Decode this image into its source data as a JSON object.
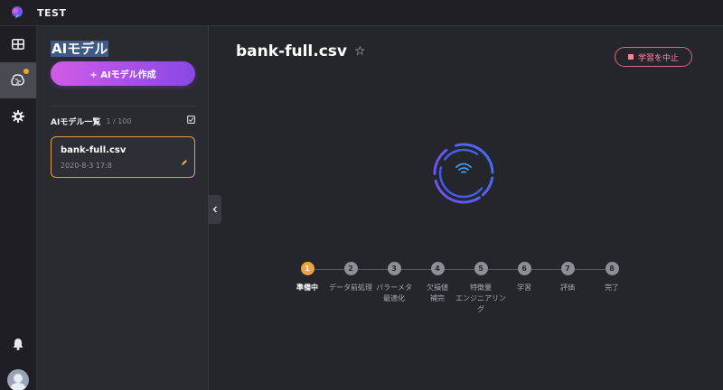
{
  "app": {
    "title": "TEST"
  },
  "colors": {
    "accent_gradient_start": "#d15ce6",
    "accent_gradient_end": "#8a48e6",
    "current_step": "#f1a23a",
    "stop_button": "#ff8aa0",
    "notification_dot": "#f5a623"
  },
  "rail": {
    "items": [
      {
        "icon": "dashboard-icon"
      },
      {
        "icon": "ai-model-icon",
        "active": true,
        "badge": true
      },
      {
        "icon": "gear-icon"
      }
    ],
    "bottom": [
      {
        "icon": "bell-icon"
      },
      {
        "icon": "avatar"
      }
    ]
  },
  "panel": {
    "title": "AIモデル",
    "create_button": "+ AIモデル作成",
    "list_title": "AIモデル一覧",
    "list_count": "1 / 100",
    "models": [
      {
        "name": "bank-full.csv",
        "date": "2020-8-3 17:8"
      }
    ]
  },
  "main": {
    "title": "bank-full.csv",
    "star": "☆",
    "stop_button": "学習を中止",
    "steps": [
      {
        "num": "1",
        "label": "準備中",
        "current": true
      },
      {
        "num": "2",
        "label": "データ前処理"
      },
      {
        "num": "3",
        "label": "パラーメタ\n最適化"
      },
      {
        "num": "4",
        "label": "欠損値\n補完"
      },
      {
        "num": "5",
        "label": "特徴量\nエンジニアリング"
      },
      {
        "num": "6",
        "label": "学習"
      },
      {
        "num": "7",
        "label": "評価"
      },
      {
        "num": "8",
        "label": "完了"
      }
    ]
  }
}
